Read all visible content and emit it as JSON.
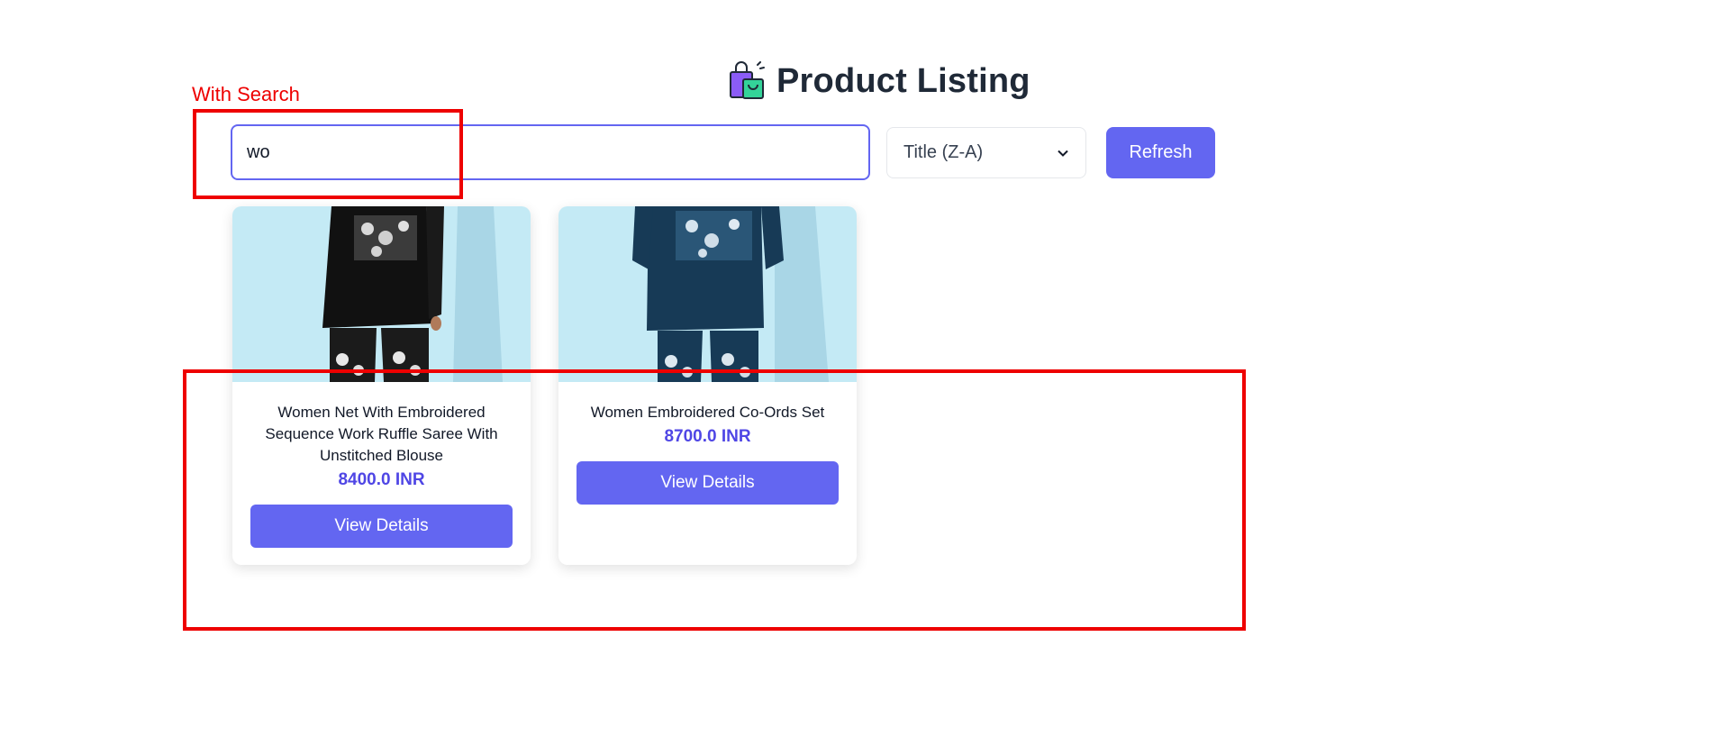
{
  "header": {
    "title": "Product Listing",
    "icon": "shopping-bags-icon"
  },
  "annotation": {
    "label": "With Search",
    "color": "#ee0000"
  },
  "search": {
    "value": "wo",
    "placeholder": ""
  },
  "sort": {
    "selected": "Title (Z-A)"
  },
  "refresh": {
    "label": "Refresh"
  },
  "products": [
    {
      "title": "Women Net With Embroidered Sequence Work Ruffle Saree With Unstitched Blouse",
      "price": "8400.0 INR",
      "button_label": "View Details",
      "image": "black embroidered co-ord outfit on light blue background"
    },
    {
      "title": "Women Embroidered Co-Ords Set",
      "price": "8700.0 INR",
      "button_label": "View Details",
      "image": "navy embroidered co-ord outfit on light blue background"
    }
  ],
  "colors": {
    "accent": "#6366f1",
    "price": "#4f46e5",
    "annotation": "#ee0000"
  }
}
